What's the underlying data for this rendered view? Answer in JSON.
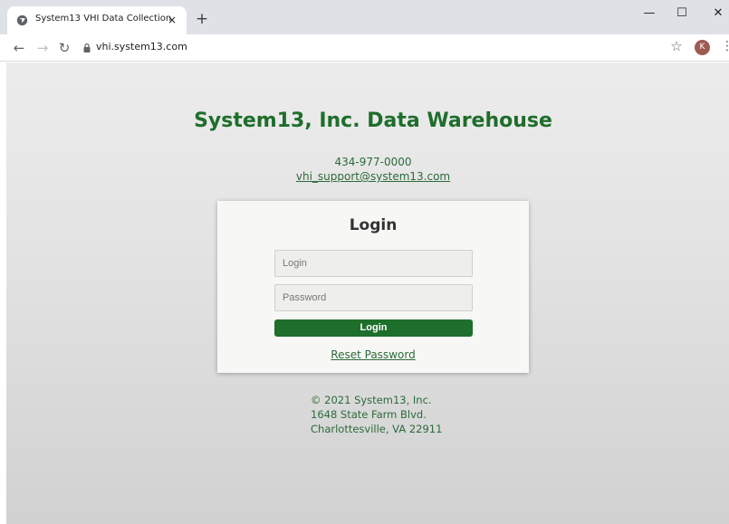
{
  "browser": {
    "tab_title": "System13 VHI Data Collection",
    "tab_close": "×",
    "new_tab": "+",
    "url": "vhi.system13.com",
    "avatar_letter": "K",
    "window_minimize": "—",
    "window_maximize": "☐",
    "window_close": "✕"
  },
  "page": {
    "title": "System13, Inc. Data Warehouse",
    "phone": "434-977-0000",
    "email": "vhi_support@system13.com"
  },
  "login": {
    "heading": "Login",
    "login_placeholder": "Login",
    "password_placeholder": "Password",
    "button_label": "Login",
    "reset_link": "Reset Password"
  },
  "footer": {
    "copyright": "© 2021 System13, Inc.",
    "address_line1": "1648 State Farm Blvd.",
    "address_line2": "Charlottesville, VA 22911"
  },
  "colors": {
    "brand_green": "#1e6e2c",
    "link_green": "#2d6a3a"
  }
}
